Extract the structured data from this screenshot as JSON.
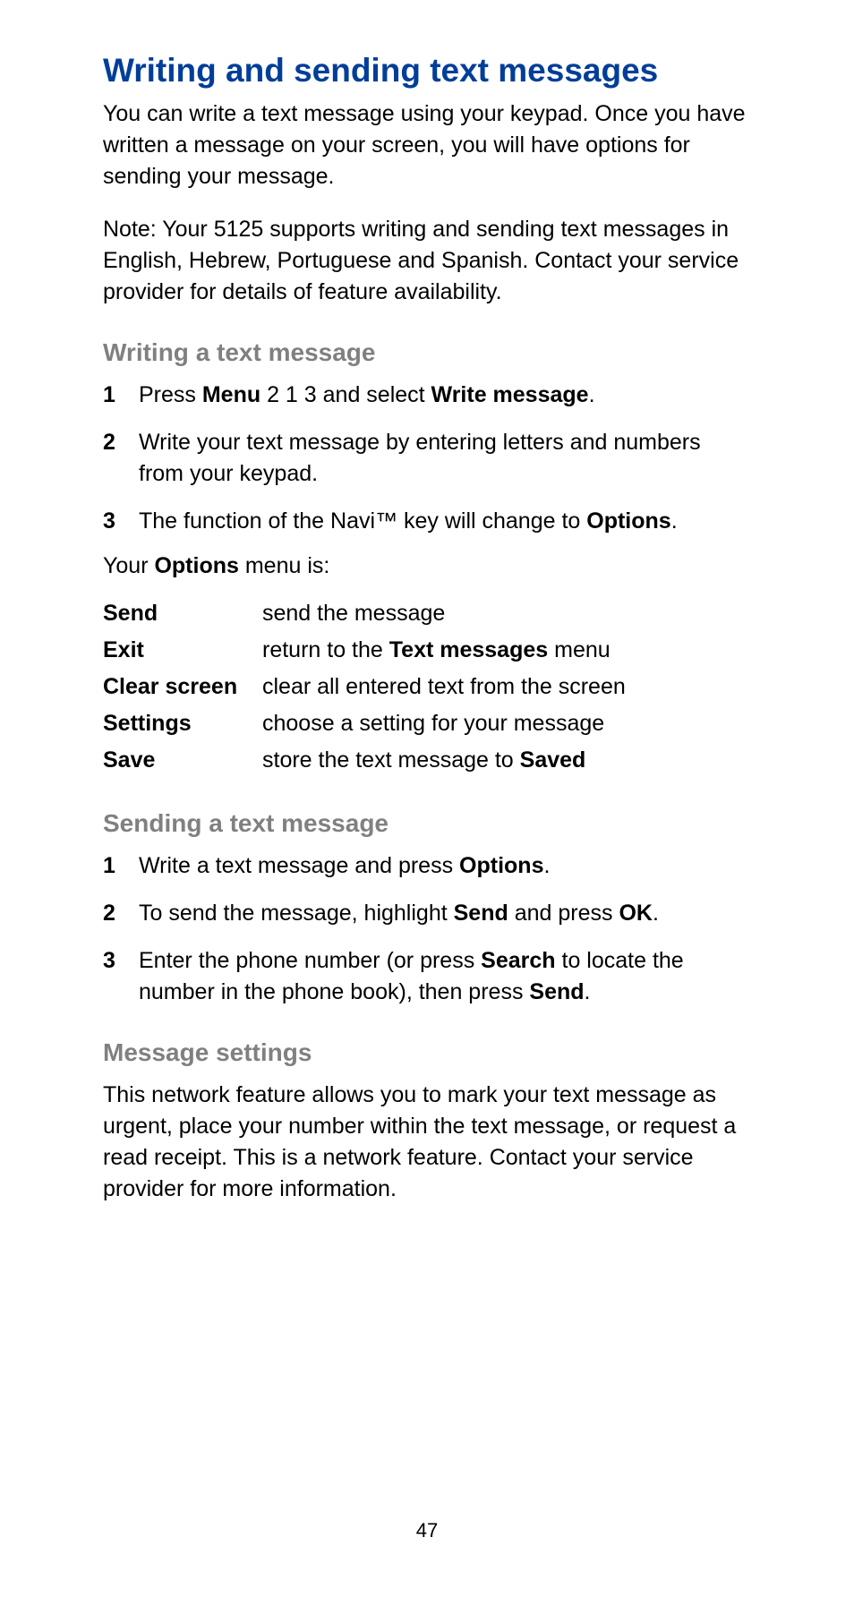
{
  "page_number": "47",
  "heading": "Writing and sending text messages",
  "intro1": "You can write a text message using your keypad. Once you have written a message on your screen, you will have options for sending your message.",
  "intro2": "Note:  Your 5125 supports writing and sending text messages in English, Hebrew, Portuguese and Spanish. Contact your service provider for details of feature availability.",
  "section1": {
    "heading": "Writing a text message",
    "steps": [
      {
        "num": "1",
        "parts": [
          "Press ",
          "Menu",
          " 2 1 3 and select ",
          "Write message",
          "."
        ]
      },
      {
        "num": "2",
        "text": "Write your text message by entering letters and numbers from your keypad."
      },
      {
        "num": "3",
        "parts": [
          "The function of the Navi™ key will change to ",
          "Options",
          "."
        ]
      }
    ],
    "options_intro_pre": "Your ",
    "options_intro_bold": "Options",
    "options_intro_post": " menu is:",
    "options": [
      {
        "label": "Send",
        "desc": "send the message"
      },
      {
        "label": "Exit",
        "desc_pre": "return to the ",
        "desc_bold": "Text messages",
        "desc_post": " menu"
      },
      {
        "label": "Clear screen",
        "desc": "clear all entered text from the screen"
      },
      {
        "label": "Settings",
        "desc": "choose a setting for your message"
      },
      {
        "label": "Save",
        "desc_pre": "store the text message to ",
        "desc_bold": "Saved",
        "desc_post": ""
      }
    ]
  },
  "section2": {
    "heading": "Sending a text message",
    "steps": [
      {
        "num": "1",
        "parts": [
          "Write a text message and press ",
          "Options",
          "."
        ]
      },
      {
        "num": "2",
        "parts": [
          "To send the message, highlight ",
          "Send",
          " and press ",
          "OK",
          "."
        ]
      },
      {
        "num": "3",
        "parts": [
          "Enter the phone number (or press ",
          "Search",
          " to locate the number in the phone book), then press ",
          "Send",
          "."
        ]
      }
    ]
  },
  "section3": {
    "heading": "Message settings",
    "body": "This network feature allows you to mark your text message as urgent, place your number within the text message, or request a read receipt. This is a network feature. Contact your service provider for more information."
  }
}
